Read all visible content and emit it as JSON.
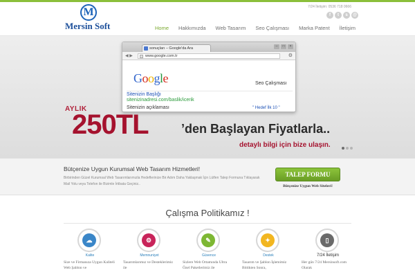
{
  "header": {
    "logo_letter": "M",
    "logo_text": "Mersin Soft",
    "hotline": "7/24 İletişim: 0536 718 0666",
    "socials": [
      "facebook-icon",
      "twitter-icon",
      "skype-icon",
      "mail-icon"
    ],
    "nav": [
      {
        "label": "Home",
        "active": true
      },
      {
        "label": "Hakkımızda",
        "active": false
      },
      {
        "label": "Web Tasarım",
        "active": false
      },
      {
        "label": "Seo Çalışması",
        "active": false
      },
      {
        "label": "Marka Patent",
        "active": false
      },
      {
        "label": "İletişim",
        "active": false
      }
    ]
  },
  "hero": {
    "browser": {
      "tab_title": "sonuçları – Google'da Ara",
      "url": "www.google.com.tr",
      "google_letters": [
        "G",
        "o",
        "o",
        "g",
        "l",
        "e"
      ],
      "seo_label": "Seo Çalışması",
      "result_title": "Sitenizin Başlığı",
      "result_url": "sitenizinadresi.com/baslik/icerik",
      "result_desc": "Sitenizin açıklaması",
      "result_target": "\" Hedef İlk 10 \""
    },
    "aylik": "AYLIK",
    "price": "250TL",
    "price_rest": "’den Başlayan Fiyatlarla..",
    "price_cta": "detaylı bilgi için bize ulaşın."
  },
  "info": {
    "title": "Bütçenize Uygun Kurumsal Web Tasarım Hizmetleri!",
    "desc": "Birbirinden Güzel Kurumsal Web Tasarımlarımızla Hedeflerinize Bir Adım Daha Yaklaşmak İçin Lütfen Talep Formuna Tıklayarak Mail Yolu veya Telefon ile Bizimle İrtibata Geçiniz..",
    "button": "TALEP FORMU",
    "button_sub": "Bütçenize Uygun Web Siteleri!"
  },
  "policies": {
    "title": "Çalışma Politikamız !",
    "items": [
      {
        "label": "Kalite",
        "icon": "cloud-icon",
        "color": "#3a86c8",
        "desc": "Size ve Firmanıza Uygun Kaliteli Web Şablon ve"
      },
      {
        "label": "Memnuniyet",
        "icon": "gears-icon",
        "color": "#c8245a",
        "desc": "Tasarımlarımız ve Desteklerimiz ile"
      },
      {
        "label": "Güvence",
        "icon": "brush-icon",
        "color": "#7db733",
        "desc": "Sizlere Web Ortamında Ultra Özel Paketlerimiz ile"
      },
      {
        "label": "Destek",
        "icon": "bulb-icon",
        "color": "#f2b620",
        "desc": "Tasarım ve Şablon İşlemimiz Bittikten Sonra,"
      },
      {
        "label": "7/24 İletişim",
        "icon": "mouse-icon",
        "color": "#6a6a6a",
        "desc": "Her gün 7/24 Mersinsoft.com Olarak"
      }
    ]
  }
}
